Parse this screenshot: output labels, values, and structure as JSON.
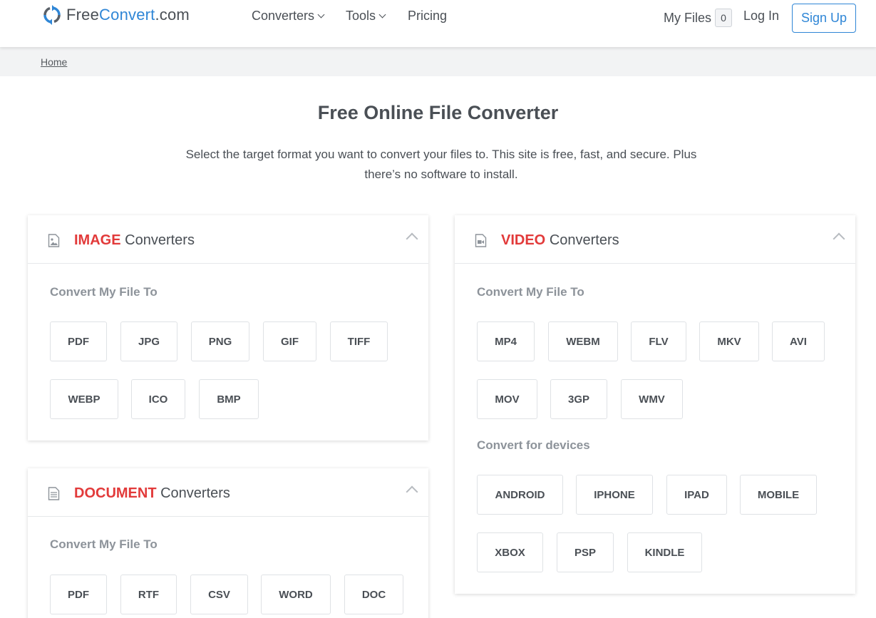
{
  "header": {
    "logo_main": "Free",
    "logo_accent": "Convert",
    "logo_suffix": ".com",
    "nav": {
      "converters": "Converters",
      "tools": "Tools",
      "pricing": "Pricing"
    },
    "my_files": "My Files",
    "file_count": "0",
    "login": "Log In",
    "signup": "Sign Up"
  },
  "breadcrumb": {
    "home": "Home"
  },
  "hero": {
    "title": "Free Online File Converter",
    "subtitle": "Select the target format you want to convert your files to. This site is free, fast, and secure. Plus there’s no software to install."
  },
  "image_card": {
    "accent": "IMAGE",
    "title_rest": "Converters",
    "section_label": "Convert My File To",
    "formats": [
      "PDF",
      "JPG",
      "PNG",
      "GIF",
      "TIFF",
      "WEBP",
      "ICO",
      "BMP"
    ]
  },
  "document_card": {
    "accent": "DOCUMENT",
    "title_rest": "Converters",
    "section_label": "Convert My File To",
    "formats": [
      "PDF",
      "RTF",
      "CSV",
      "WORD",
      "DOC"
    ]
  },
  "video_card": {
    "accent": "VIDEO",
    "title_rest": "Converters",
    "section_label": "Convert My File To",
    "formats": [
      "MP4",
      "WEBM",
      "FLV",
      "MKV",
      "AVI",
      "MOV",
      "3GP",
      "WMV"
    ],
    "devices_label": "Convert for devices",
    "devices": [
      "ANDROID",
      "IPHONE",
      "IPAD",
      "MOBILE",
      "XBOX",
      "PSP",
      "KINDLE"
    ]
  },
  "colors": {
    "brand_blue": "#2f86d6",
    "accent_red": "#e23a3a",
    "text": "#4a4f55",
    "muted": "#8d939a"
  },
  "icons": {
    "logo": "refresh-arrows-icon",
    "image": "image-file-icon",
    "video": "video-file-icon",
    "document": "document-file-icon"
  }
}
